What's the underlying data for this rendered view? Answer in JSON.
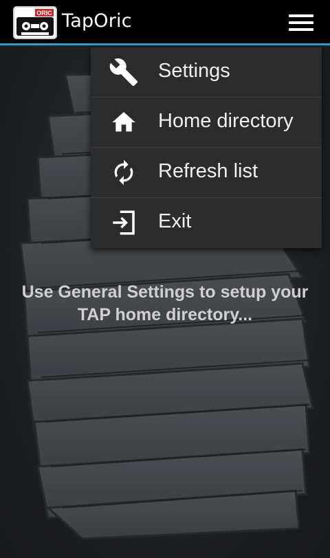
{
  "action_bar": {
    "title": "TapOric",
    "icon_badge": "ORIC",
    "menu_icon": "hamburger-menu-icon"
  },
  "overflow_menu": {
    "items": [
      {
        "label": "Settings",
        "icon": "wrench-icon"
      },
      {
        "label": "Home directory",
        "icon": "home-icon"
      },
      {
        "label": "Refresh list",
        "icon": "refresh-icon"
      },
      {
        "label": "Exit",
        "icon": "exit-icon"
      }
    ]
  },
  "main": {
    "hint": "Use General Settings to setup your TAP home directory..."
  },
  "colors": {
    "action_bar_bg": "#000000",
    "action_bar_accent": "#2f9ed2",
    "menu_bg": "#2b2c2e",
    "hint_text": "#d0d0d0"
  }
}
